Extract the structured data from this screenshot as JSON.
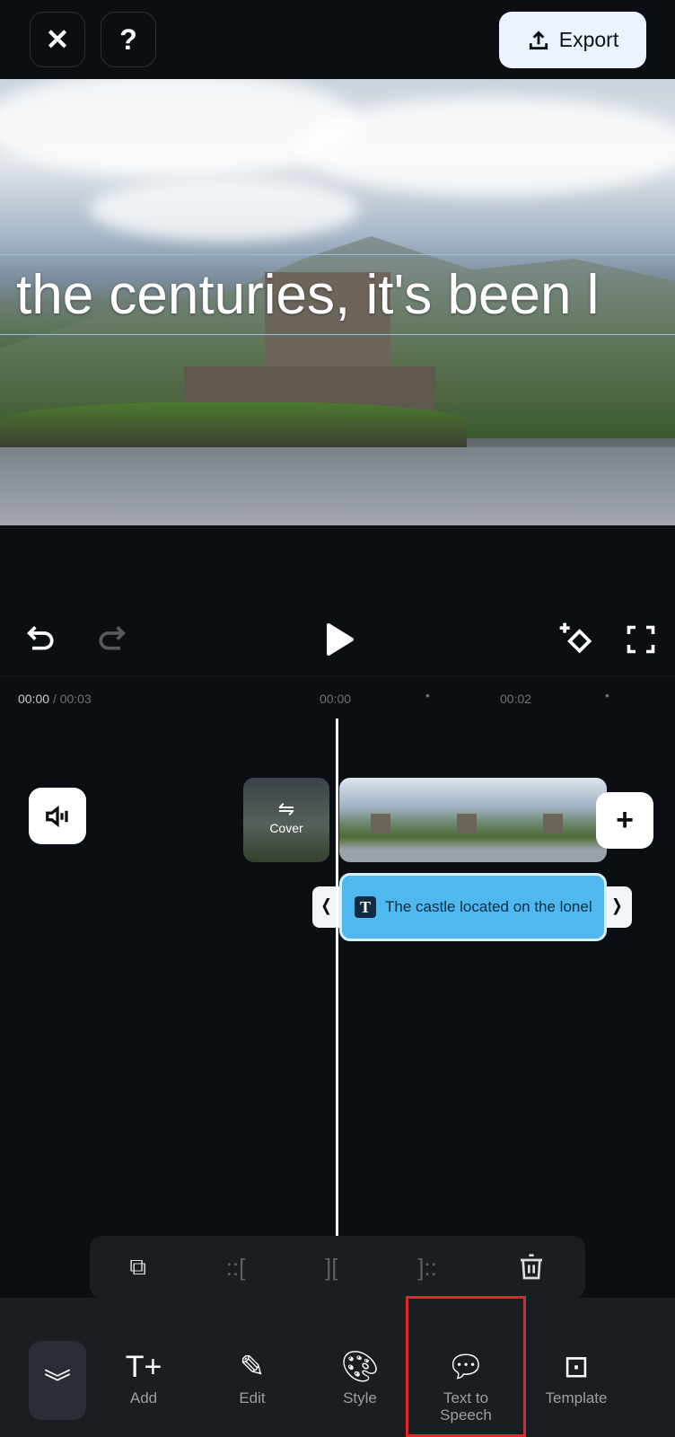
{
  "header": {
    "close_icon": "close-icon",
    "help_label": "?",
    "export_label": "Export"
  },
  "preview": {
    "caption": "the centuries, it's been l"
  },
  "controls": {
    "undo": "undo-icon",
    "redo": "redo-icon",
    "play": "play-icon",
    "keyframe": "keyframe-icon",
    "fullscreen": "fullscreen-icon"
  },
  "timeline": {
    "current": "00:00",
    "total": "/ 00:03",
    "ticks": [
      "00:00",
      "00:02"
    ],
    "cover_label": "Cover",
    "text_clip": "The castle located on the lonel"
  },
  "toolbar": {
    "icons": [
      "duplicate-icon",
      "split-left-icon",
      "split-icon",
      "split-right-icon",
      "delete-icon"
    ]
  },
  "nav": {
    "items": [
      {
        "label": "Add"
      },
      {
        "label": "Edit"
      },
      {
        "label": "Style"
      },
      {
        "label": "Text to Speech"
      },
      {
        "label": "Template"
      }
    ],
    "highlight_color": "#e0262b"
  },
  "colors": {
    "text_clip": "#4fb8ee",
    "background": "#0b0e12"
  }
}
